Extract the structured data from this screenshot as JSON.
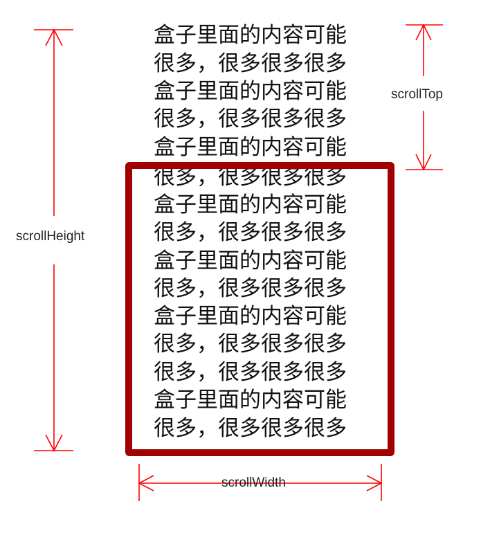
{
  "content_lines": [
    "盒子里面的内容可能",
    "很多，很多很多很多",
    "盒子里面的内容可能",
    "很多，很多很多很多",
    "盒子里面的内容可能",
    "很多，很多很多很多",
    "盒子里面的内容可能",
    "很多，很多很多很多",
    "盒子里面的内容可能",
    "很多，很多很多很多",
    "盒子里面的内容可能",
    "很多，很多很多很多",
    "很多，很多很多很多",
    "盒子里面的内容可能",
    "很多，很多很多很多"
  ],
  "labels": {
    "scroll_height": "scrollHeight",
    "scroll_top": "scrollTop",
    "scroll_width": "scrollWidth"
  },
  "colors": {
    "dimension_line": "#ff0000",
    "viewport_border": "#a00000"
  }
}
